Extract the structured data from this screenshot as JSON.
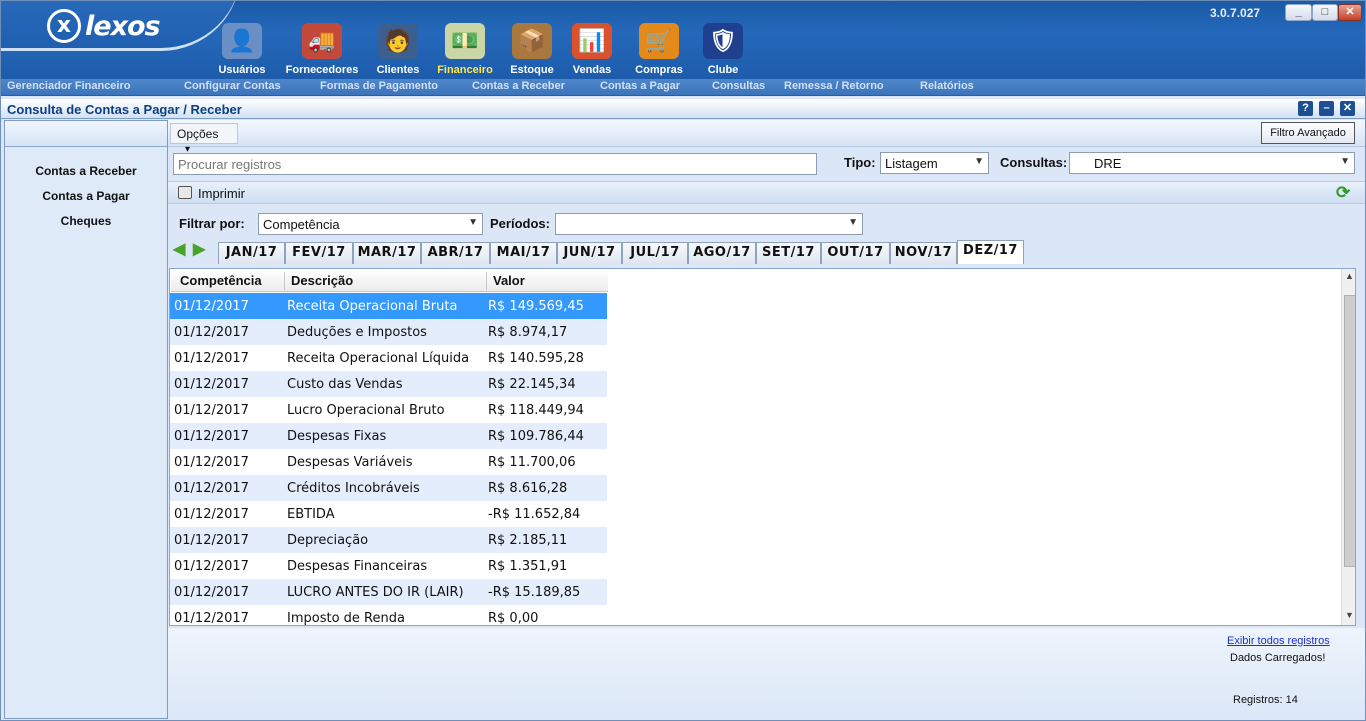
{
  "app": {
    "version": "3.0.7.027",
    "logo_text": "lexos",
    "logo_mark": "x"
  },
  "modules": [
    {
      "label": "Usuários",
      "icon": "users-icon",
      "glyph": "👤"
    },
    {
      "label": "Fornecedores",
      "icon": "truck-icon",
      "glyph": "🚚"
    },
    {
      "label": "Clientes",
      "icon": "client-icon",
      "glyph": "🧑"
    },
    {
      "label": "Financeiro",
      "icon": "money-icon",
      "glyph": "💵"
    },
    {
      "label": "Estoque",
      "icon": "boxes-icon",
      "glyph": "📦"
    },
    {
      "label": "Vendas",
      "icon": "sales-chart-icon",
      "glyph": "📊"
    },
    {
      "label": "Compras",
      "icon": "cart-icon",
      "glyph": "🛒"
    },
    {
      "label": "Clube",
      "icon": "club-shield-icon",
      "glyph": "🛡"
    }
  ],
  "active_module": "Financeiro",
  "nav": [
    "Gerenciador Financeiro",
    "Configurar Contas",
    "Formas de Pagamento",
    "Contas a Receber",
    "Contas a Pagar",
    "Consultas",
    "Remessa / Retorno",
    "Relatórios"
  ],
  "window": {
    "title": "Consulta de Contas a Pagar / Receber",
    "help": "?",
    "min": "–",
    "close": "✕"
  },
  "sidebar": {
    "items": [
      "Contas a Receber",
      "Contas a Pagar",
      "Cheques"
    ]
  },
  "toolbar": {
    "options_label": "Opções",
    "options_arrow": "▾",
    "advanced_filter": "Filtro Avançado",
    "print_label": "Imprimir",
    "refresh_glyph": "⟳"
  },
  "search": {
    "placeholder": "Procurar registros",
    "value": ""
  },
  "tipo": {
    "label": "Tipo:",
    "value": "Listagem"
  },
  "consultas": {
    "label": "Consultas:",
    "value": "DRE"
  },
  "filtrar": {
    "label": "Filtrar por:",
    "value": "Competência"
  },
  "periodos": {
    "label": "Períodos:",
    "value": ""
  },
  "month_tabs": [
    "JAN/17",
    "FEV/17",
    "MAR/17",
    "ABR/17",
    "MAI/17",
    "JUN/17",
    "JUL/17",
    "AGO/17",
    "SET/17",
    "OUT/17",
    "NOV/17",
    "DEZ/17"
  ],
  "selected_month": "DEZ/17",
  "table": {
    "columns": [
      "Competência",
      "Descrição",
      "Valor"
    ],
    "rows": [
      [
        "01/12/2017",
        "Receita Operacional Bruta",
        "R$ 149.569,45"
      ],
      [
        "01/12/2017",
        "Deduções e Impostos",
        "R$ 8.974,17"
      ],
      [
        "01/12/2017",
        "Receita Operacional Líquida",
        "R$ 140.595,28"
      ],
      [
        "01/12/2017",
        "Custo das Vendas",
        "R$ 22.145,34"
      ],
      [
        "01/12/2017",
        "Lucro Operacional Bruto",
        "R$ 118.449,94"
      ],
      [
        "01/12/2017",
        "Despesas Fixas",
        "R$ 109.786,44"
      ],
      [
        "01/12/2017",
        "Despesas Variáveis",
        "R$ 11.700,06"
      ],
      [
        "01/12/2017",
        "Créditos Incobráveis",
        "R$ 8.616,28"
      ],
      [
        "01/12/2017",
        "EBTIDA",
        "-R$ 11.652,84"
      ],
      [
        "01/12/2017",
        "Depreciação",
        "R$ 2.185,11"
      ],
      [
        "01/12/2017",
        "Despesas Financeiras",
        "R$ 1.351,91"
      ],
      [
        "01/12/2017",
        "LUCRO ANTES DO IR (LAIR)",
        "-R$ 15.189,85"
      ],
      [
        "01/12/2017",
        "Imposto de Renda",
        "R$ 0,00"
      ]
    ],
    "selected_row": 0
  },
  "footer": {
    "show_all": "Exibir todos registros",
    "status": "Dados Carregados!",
    "count": "Registros: 14"
  },
  "colors": {
    "selected_row": "#3399ff",
    "alt_row": "#e4edfb",
    "title_bar": "#1d5cab"
  }
}
